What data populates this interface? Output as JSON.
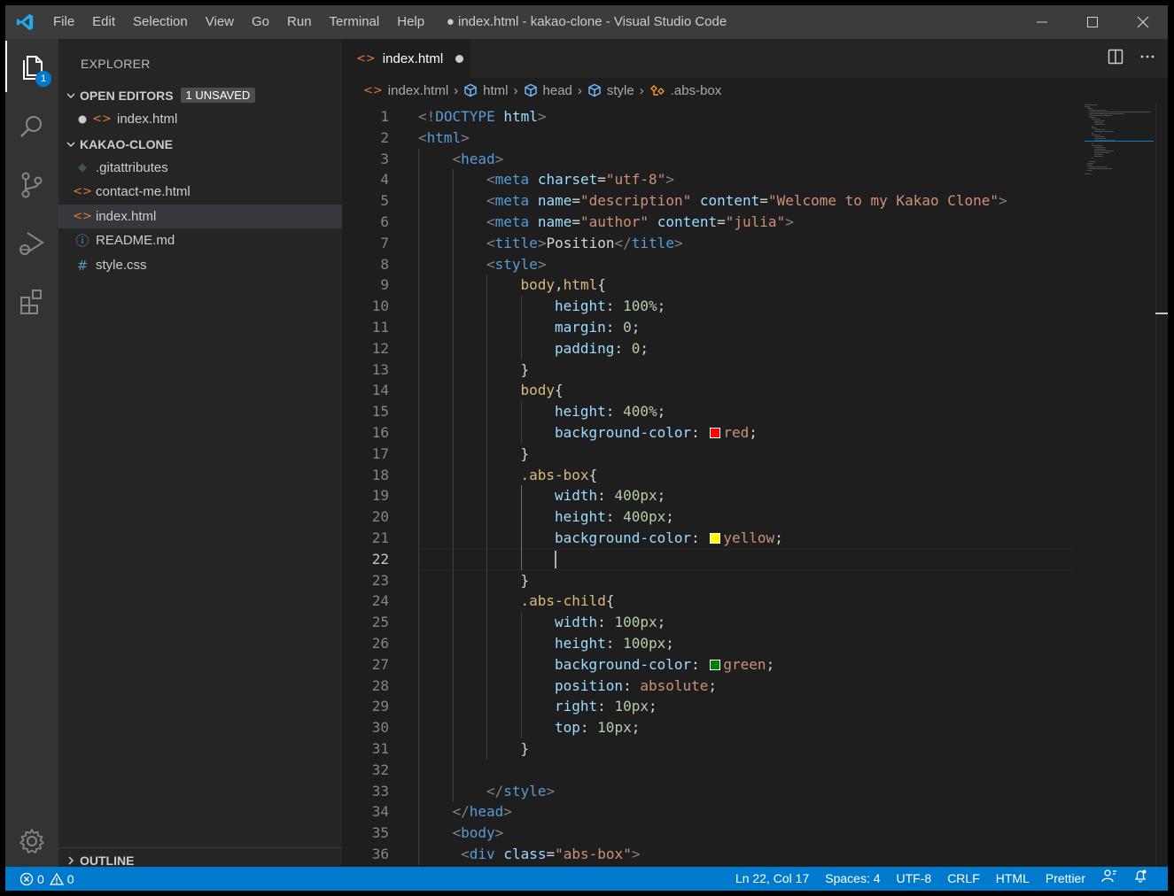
{
  "titlebar": {
    "menu": [
      "File",
      "Edit",
      "Selection",
      "View",
      "Go",
      "Run",
      "Terminal",
      "Help"
    ],
    "title": "● index.html - kakao-clone - Visual Studio Code"
  },
  "activitybar": {
    "items": [
      "files-icon",
      "search-icon",
      "source-control-icon",
      "run-debug-icon",
      "extensions-icon"
    ],
    "explorer_badge": "1",
    "bottom": "settings-gear-icon"
  },
  "sidebar": {
    "title": "EXPLORER",
    "open_editors": {
      "label": "OPEN EDITORS",
      "badge": "1 UNSAVED",
      "files": [
        {
          "name": "index.html",
          "icon": "html-icon",
          "dirty": true
        }
      ]
    },
    "project": {
      "label": "KAKAO-CLONE",
      "files": [
        {
          "name": ".gitattributes",
          "icon": "git-icon"
        },
        {
          "name": "contact-me.html",
          "icon": "html-icon"
        },
        {
          "name": "index.html",
          "icon": "html-icon",
          "selected": true
        },
        {
          "name": "README.md",
          "icon": "info-icon"
        },
        {
          "name": "style.css",
          "icon": "css-icon"
        }
      ]
    },
    "outline_label": "OUTLINE"
  },
  "editor": {
    "tab": {
      "label": "index.html",
      "dirty": true
    },
    "breadcrumb": [
      "index.html",
      "html",
      "head",
      "style",
      ".abs-box"
    ],
    "current_line": 22,
    "lines": [
      {
        "n": "1",
        "indent": 0,
        "parts": [
          [
            "t",
            "<!"
          ],
          [
            "tag",
            "DOCTYPE"
          ],
          [
            "plain",
            " "
          ],
          [
            "attr",
            "html"
          ],
          [
            "t",
            ">"
          ]
        ]
      },
      {
        "n": "2",
        "indent": 0,
        "parts": [
          [
            "t",
            "<"
          ],
          [
            "tag",
            "html"
          ],
          [
            "t",
            ">"
          ]
        ]
      },
      {
        "n": "3",
        "indent": 1,
        "parts": [
          [
            "t",
            "<"
          ],
          [
            "tag",
            "head"
          ],
          [
            "t",
            ">"
          ]
        ]
      },
      {
        "n": "4",
        "indent": 2,
        "parts": [
          [
            "t",
            "<"
          ],
          [
            "tag",
            "meta"
          ],
          [
            "plain",
            " "
          ],
          [
            "attr",
            "charset"
          ],
          [
            "plain",
            "="
          ],
          [
            "str",
            "\"utf-8\""
          ],
          [
            "t",
            ">"
          ]
        ]
      },
      {
        "n": "5",
        "indent": 2,
        "parts": [
          [
            "t",
            "<"
          ],
          [
            "tag",
            "meta"
          ],
          [
            "plain",
            " "
          ],
          [
            "attr",
            "name"
          ],
          [
            "plain",
            "="
          ],
          [
            "str",
            "\"description\""
          ],
          [
            "plain",
            " "
          ],
          [
            "attr",
            "content"
          ],
          [
            "plain",
            "="
          ],
          [
            "str",
            "\"Welcome to my Kakao Clone\""
          ],
          [
            "t",
            ">"
          ]
        ]
      },
      {
        "n": "6",
        "indent": 2,
        "parts": [
          [
            "t",
            "<"
          ],
          [
            "tag",
            "meta"
          ],
          [
            "plain",
            " "
          ],
          [
            "attr",
            "name"
          ],
          [
            "plain",
            "="
          ],
          [
            "str",
            "\"author\""
          ],
          [
            "plain",
            " "
          ],
          [
            "attr",
            "content"
          ],
          [
            "plain",
            "="
          ],
          [
            "str",
            "\"julia\""
          ],
          [
            "t",
            ">"
          ]
        ]
      },
      {
        "n": "7",
        "indent": 2,
        "parts": [
          [
            "t",
            "<"
          ],
          [
            "tag",
            "title"
          ],
          [
            "t",
            ">"
          ],
          [
            "plain",
            "Position"
          ],
          [
            "t",
            "</"
          ],
          [
            "tag",
            "title"
          ],
          [
            "t",
            ">"
          ]
        ]
      },
      {
        "n": "8",
        "indent": 2,
        "parts": [
          [
            "t",
            "<"
          ],
          [
            "tag",
            "style"
          ],
          [
            "t",
            ">"
          ]
        ]
      },
      {
        "n": "9",
        "indent": 3,
        "parts": [
          [
            "sel",
            "body"
          ],
          [
            "plain",
            ","
          ],
          [
            "sel",
            "html"
          ],
          [
            "plain",
            "{"
          ]
        ]
      },
      {
        "n": "10",
        "indent": 4,
        "parts": [
          [
            "prop",
            "height"
          ],
          [
            "plain",
            ": "
          ],
          [
            "num",
            "100%"
          ],
          [
            "plain",
            ";"
          ]
        ]
      },
      {
        "n": "11",
        "indent": 4,
        "parts": [
          [
            "prop",
            "margin"
          ],
          [
            "plain",
            ": "
          ],
          [
            "num",
            "0"
          ],
          [
            "plain",
            ";"
          ]
        ]
      },
      {
        "n": "12",
        "indent": 4,
        "parts": [
          [
            "prop",
            "padding"
          ],
          [
            "plain",
            ": "
          ],
          [
            "num",
            "0"
          ],
          [
            "plain",
            ";"
          ]
        ]
      },
      {
        "n": "13",
        "indent": 3,
        "parts": [
          [
            "plain",
            "}"
          ]
        ]
      },
      {
        "n": "14",
        "indent": 3,
        "parts": [
          [
            "sel",
            "body"
          ],
          [
            "plain",
            "{"
          ]
        ]
      },
      {
        "n": "15",
        "indent": 4,
        "parts": [
          [
            "prop",
            "height"
          ],
          [
            "plain",
            ": "
          ],
          [
            "num",
            "400%"
          ],
          [
            "plain",
            ";"
          ]
        ]
      },
      {
        "n": "16",
        "indent": 4,
        "parts": [
          [
            "prop",
            "background-color"
          ],
          [
            "plain",
            ": "
          ],
          [
            "swatch",
            "#ff0000"
          ],
          [
            "val",
            "red"
          ],
          [
            "plain",
            ";"
          ]
        ]
      },
      {
        "n": "17",
        "indent": 3,
        "parts": [
          [
            "plain",
            "}"
          ]
        ]
      },
      {
        "n": "18",
        "indent": 3,
        "parts": [
          [
            "sel",
            ".abs-box"
          ],
          [
            "plain",
            "{"
          ]
        ]
      },
      {
        "n": "19",
        "indent": 4,
        "parts": [
          [
            "prop",
            "width"
          ],
          [
            "plain",
            ": "
          ],
          [
            "num",
            "400px"
          ],
          [
            "plain",
            ";"
          ]
        ]
      },
      {
        "n": "20",
        "indent": 4,
        "parts": [
          [
            "prop",
            "height"
          ],
          [
            "plain",
            ": "
          ],
          [
            "num",
            "400px"
          ],
          [
            "plain",
            ";"
          ]
        ]
      },
      {
        "n": "21",
        "indent": 4,
        "parts": [
          [
            "prop",
            "background-color"
          ],
          [
            "plain",
            ": "
          ],
          [
            "swatch",
            "#ffff00"
          ],
          [
            "val",
            "yellow"
          ],
          [
            "plain",
            ";"
          ]
        ]
      },
      {
        "n": "22",
        "indent": 4,
        "parts": []
      },
      {
        "n": "23",
        "indent": 3,
        "parts": [
          [
            "plain",
            "}"
          ]
        ]
      },
      {
        "n": "24",
        "indent": 3,
        "parts": [
          [
            "sel",
            ".abs-child"
          ],
          [
            "plain",
            "{"
          ]
        ]
      },
      {
        "n": "25",
        "indent": 4,
        "parts": [
          [
            "prop",
            "width"
          ],
          [
            "plain",
            ": "
          ],
          [
            "num",
            "100px"
          ],
          [
            "plain",
            ";"
          ]
        ]
      },
      {
        "n": "26",
        "indent": 4,
        "parts": [
          [
            "prop",
            "height"
          ],
          [
            "plain",
            ": "
          ],
          [
            "num",
            "100px"
          ],
          [
            "plain",
            ";"
          ]
        ]
      },
      {
        "n": "27",
        "indent": 4,
        "parts": [
          [
            "prop",
            "background-color"
          ],
          [
            "plain",
            ": "
          ],
          [
            "swatch",
            "#008000"
          ],
          [
            "val",
            "green"
          ],
          [
            "plain",
            ";"
          ]
        ]
      },
      {
        "n": "28",
        "indent": 4,
        "parts": [
          [
            "prop",
            "position"
          ],
          [
            "plain",
            ": "
          ],
          [
            "val",
            "absolute"
          ],
          [
            "plain",
            ";"
          ]
        ]
      },
      {
        "n": "29",
        "indent": 4,
        "parts": [
          [
            "prop",
            "right"
          ],
          [
            "plain",
            ": "
          ],
          [
            "num",
            "10px"
          ],
          [
            "plain",
            ";"
          ]
        ]
      },
      {
        "n": "30",
        "indent": 4,
        "parts": [
          [
            "prop",
            "top"
          ],
          [
            "plain",
            ": "
          ],
          [
            "num",
            "10px"
          ],
          [
            "plain",
            ";"
          ]
        ]
      },
      {
        "n": "31",
        "indent": 3,
        "parts": [
          [
            "plain",
            "}"
          ]
        ]
      },
      {
        "n": "32",
        "indent": 2,
        "parts": []
      },
      {
        "n": "33",
        "indent": 2,
        "parts": [
          [
            "t",
            "</"
          ],
          [
            "tag",
            "style"
          ],
          [
            "t",
            ">"
          ]
        ]
      },
      {
        "n": "34",
        "indent": 1,
        "parts": [
          [
            "t",
            "</"
          ],
          [
            "tag",
            "head"
          ],
          [
            "t",
            ">"
          ]
        ]
      },
      {
        "n": "35",
        "indent": 1,
        "parts": [
          [
            "t",
            "<"
          ],
          [
            "tag",
            "body"
          ],
          [
            "t",
            ">"
          ]
        ]
      },
      {
        "n": "36",
        "indent": 1.25,
        "parts": [
          [
            "t",
            "<"
          ],
          [
            "tag",
            "div"
          ],
          [
            "plain",
            " "
          ],
          [
            "attr",
            "class"
          ],
          [
            "plain",
            "="
          ],
          [
            "str",
            "\"abs-box\""
          ],
          [
            "t",
            ">"
          ]
        ]
      }
    ]
  },
  "statusbar": {
    "errors": "0",
    "warnings": "0",
    "right": [
      "Ln 22, Col 17",
      "Spaces: 4",
      "UTF-8",
      "CRLF",
      "HTML",
      "Prettier"
    ]
  }
}
